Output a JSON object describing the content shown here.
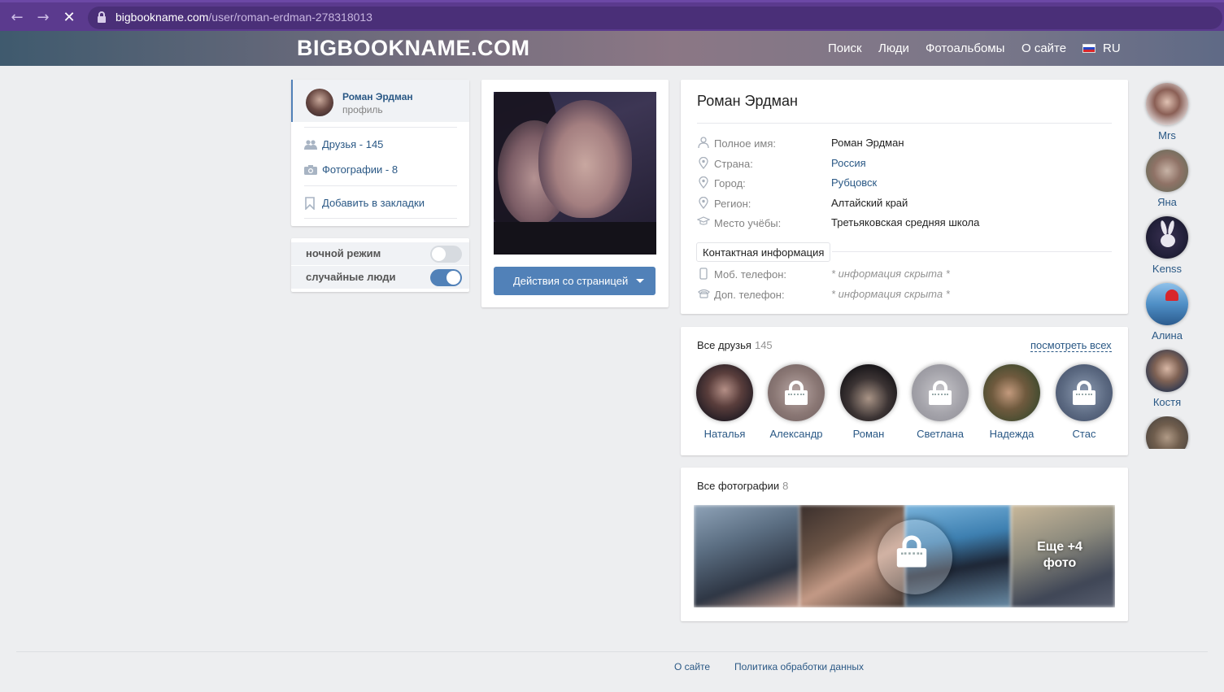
{
  "browser": {
    "url_host": "bigbookname.com",
    "url_path": "/user/roman-erdman-278318013",
    "back_icon": "arrow-left-icon",
    "forward_icon": "arrow-right-icon",
    "stop_icon": "close-icon"
  },
  "header": {
    "logo": "BIGBOOKNAME.COM",
    "nav": [
      "Поиск",
      "Люди",
      "Фотоальбомы",
      "О сайте"
    ],
    "lang": "RU"
  },
  "left_menu": {
    "name": "Роман Эрдман",
    "sub": "профиль",
    "friends": "Друзья - 145",
    "photos": "Фотографии - 8",
    "bookmark": "Добавить в закладки"
  },
  "toggles": {
    "night_mode": "ночной режим",
    "night_mode_on": false,
    "random_people": "случайные люди",
    "random_people_on": true
  },
  "photo_card": {
    "action_button": "Действия со страницей"
  },
  "profile": {
    "title": "Роман Эрдман",
    "fields": [
      {
        "label": "Полное имя:",
        "value": "Роман Эрдман",
        "icon": "user-icon"
      },
      {
        "label": "Страна:",
        "value": "Россия",
        "icon": "location-icon"
      },
      {
        "label": "Город:",
        "value": "Рубцовск",
        "icon": "location-icon"
      },
      {
        "label": "Регион:",
        "value": "Алтайский край",
        "icon": "location-icon"
      },
      {
        "label": "Место учёбы:",
        "value": "Третьяковская средняя школа",
        "icon": "graduation-cap-icon"
      }
    ],
    "contact_tab": "Контактная информация",
    "contacts": [
      {
        "label": "Моб. телефон:",
        "value": "* информация скрыта *",
        "icon": "mobile-phone-icon"
      },
      {
        "label": "Доп. телефон:",
        "value": "* информация скрыта *",
        "icon": "phone-icon"
      }
    ]
  },
  "friends": {
    "title": "Все друзья",
    "count": "145",
    "see_all": "посмотреть всех",
    "items": [
      {
        "name": "Наталья",
        "locked": false
      },
      {
        "name": "Александр",
        "locked": true
      },
      {
        "name": "Роман",
        "locked": false
      },
      {
        "name": "Светлана",
        "locked": true
      },
      {
        "name": "Надежда",
        "locked": false
      },
      {
        "name": "Стас",
        "locked": true
      }
    ]
  },
  "photos": {
    "title": "Все фотографии",
    "count": "8",
    "more_line1": "Еще +4",
    "more_line2": "фото"
  },
  "right_people": [
    "Mrs",
    "Яна",
    "Kenss",
    "Алина",
    "Костя"
  ],
  "footer": {
    "about": "О сайте",
    "privacy": "Политика обработки данных"
  },
  "colors": {
    "accent": "#5181b8",
    "link": "#2a5885",
    "browser_bar": "#5b3a8e"
  }
}
